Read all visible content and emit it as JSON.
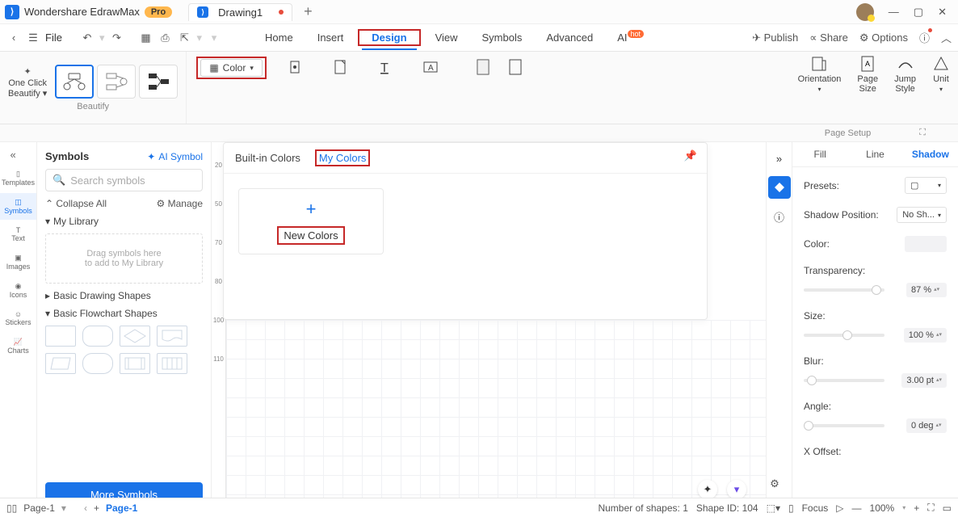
{
  "titlebar": {
    "app_name": "Wondershare EdrawMax",
    "pro_badge": "Pro",
    "tab_name": "Drawing1"
  },
  "menubar": {
    "file": "File",
    "tabs": [
      "Home",
      "Insert",
      "Design",
      "View",
      "Symbols",
      "Advanced",
      "AI"
    ],
    "ai_badge": "hot",
    "publish": "Publish",
    "share": "Share",
    "options": "Options"
  },
  "ribbon": {
    "one_click": "One Click",
    "beautify": "Beautify",
    "beautify_label": "Beautify",
    "color_btn": "Color",
    "builtin": "Built-in Colors",
    "mycolors": "My Colors",
    "new_colors": "New Colors",
    "orientation": "Orientation",
    "page_size": "Page\nSize",
    "jump_style": "Jump\nStyle",
    "unit": "Unit",
    "page_setup": "Page Setup"
  },
  "leftbar": {
    "items": [
      "Templates",
      "Symbols",
      "Text",
      "Images",
      "Icons",
      "Stickers",
      "Charts"
    ]
  },
  "symbolpane": {
    "title": "Symbols",
    "ai": "AI Symbol",
    "search_ph": "Search symbols",
    "collapse": "Collapse All",
    "manage": "Manage",
    "mylib": "My Library",
    "drag_hint1": "Drag symbols here",
    "drag_hint2": "to add to My Library",
    "basic_drawing": "Basic Drawing Shapes",
    "basic_flow": "Basic Flowchart Shapes",
    "more": "More Symbols"
  },
  "ruler_ticks": [
    "20",
    "50",
    "70",
    "80",
    "100",
    "110"
  ],
  "rightpanel": {
    "tabs": [
      "Fill",
      "Line",
      "Shadow"
    ],
    "presets": "Presets:",
    "shadow_pos": "Shadow Position:",
    "shadow_pos_val": "No Sh...",
    "color": "Color:",
    "transparency": "Transparency:",
    "transparency_val": "87 %",
    "size": "Size:",
    "size_val": "100 %",
    "blur": "Blur:",
    "blur_val": "3.00 pt",
    "angle": "Angle:",
    "angle_val": "0 deg",
    "xoffset": "X Offset:"
  },
  "statusbar": {
    "page1": "Page-1",
    "page_active": "Page-1",
    "shapes": "Number of shapes: 1",
    "shape_id": "Shape ID: 104",
    "focus": "Focus",
    "zoom": "100%"
  }
}
